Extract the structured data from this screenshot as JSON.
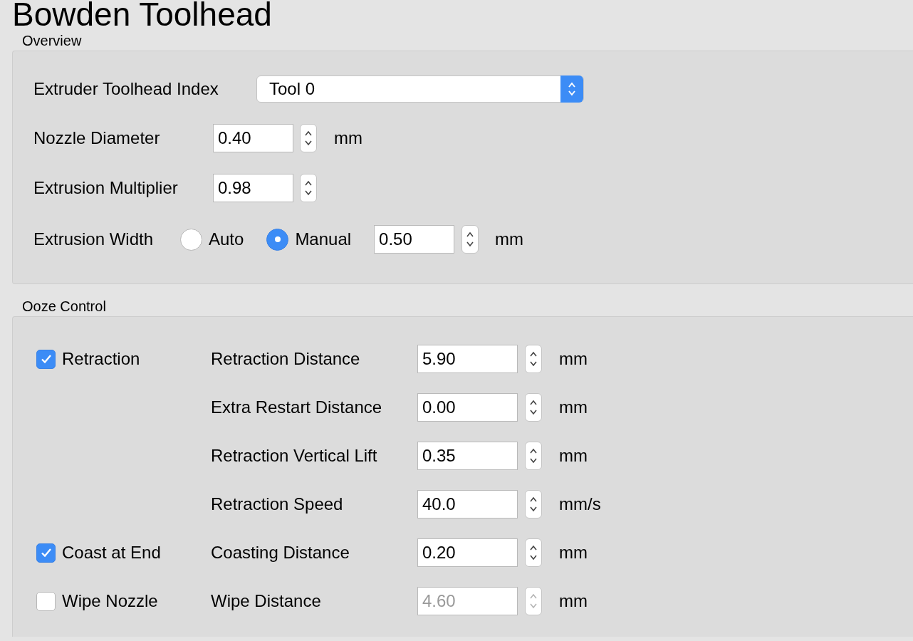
{
  "title": "Bowden Toolhead",
  "overview": {
    "label": "Overview",
    "toolhead_index": {
      "label": "Extruder Toolhead Index",
      "value": "Tool 0"
    },
    "spins": [
      {
        "label": "Nozzle Diameter",
        "value": "0.40",
        "unit": "mm"
      },
      {
        "label": "Extrusion Multiplier",
        "value": "0.98"
      }
    ],
    "extrusion_width": {
      "label": "Extrusion Width",
      "options": [
        {
          "label": "Auto",
          "selected": false
        },
        {
          "label": "Manual",
          "selected": true
        }
      ],
      "value": "0.50",
      "unit": "mm"
    }
  },
  "ooze": {
    "label": "Ooze Control",
    "rows": [
      {
        "checkbox": {
          "label": "Retraction",
          "checked": true
        },
        "label": "Retraction Distance",
        "value": "5.90",
        "unit": "mm",
        "disabled": false
      },
      {
        "label": "Extra Restart Distance",
        "value": "0.00",
        "unit": "mm",
        "disabled": false
      },
      {
        "label": "Retraction Vertical Lift",
        "value": "0.35",
        "unit": "mm",
        "disabled": false
      },
      {
        "label": "Retraction Speed",
        "value": "40.0",
        "unit": "mm/s",
        "disabled": false
      },
      {
        "checkbox": {
          "label": "Coast at End",
          "checked": true
        },
        "label": "Coasting Distance",
        "value": "0.20",
        "unit": "mm",
        "disabled": false
      },
      {
        "checkbox": {
          "label": "Wipe Nozzle",
          "checked": false
        },
        "label": "Wipe Distance",
        "value": "4.60",
        "unit": "mm",
        "disabled": true
      }
    ]
  }
}
